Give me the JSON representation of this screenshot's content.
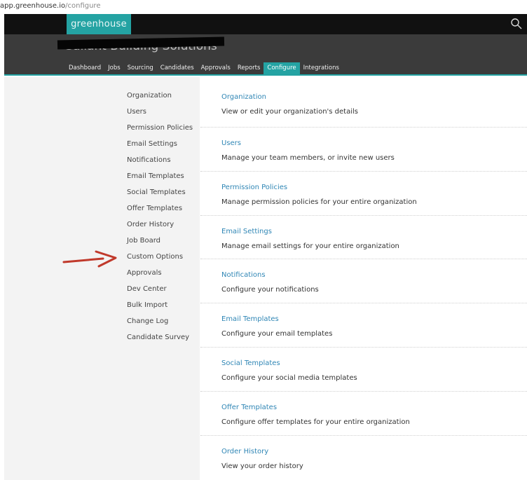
{
  "browser": {
    "url_host": "app.greenhouse.io",
    "url_path": "/configure"
  },
  "header": {
    "logo_text": "greenhouse",
    "org_name": "Gallant Building Solutions",
    "search_icon": "search-icon"
  },
  "nav": {
    "items": [
      {
        "label": "Dashboard"
      },
      {
        "label": "Jobs"
      },
      {
        "label": "Sourcing"
      },
      {
        "label": "Candidates"
      },
      {
        "label": "Approvals"
      },
      {
        "label": "Reports"
      },
      {
        "label": "Configure",
        "active": true
      },
      {
        "label": "Integrations"
      }
    ],
    "active_color": "#24a3a3"
  },
  "sidebar": {
    "items": [
      {
        "label": "Organization"
      },
      {
        "label": "Users"
      },
      {
        "label": "Permission Policies"
      },
      {
        "label": "Email Settings"
      },
      {
        "label": "Notifications"
      },
      {
        "label": "Email Templates"
      },
      {
        "label": "Social Templates"
      },
      {
        "label": "Offer Templates"
      },
      {
        "label": "Order History"
      },
      {
        "label": "Job Board"
      },
      {
        "label": "Custom Options"
      },
      {
        "label": "Approvals"
      },
      {
        "label": "Dev Center"
      },
      {
        "label": "Bulk Import"
      },
      {
        "label": "Change Log"
      },
      {
        "label": "Candidate Survey"
      }
    ]
  },
  "annotation": {
    "arrow_icon": "arrow-right-icon",
    "arrow_color": "#c0392b"
  },
  "main": {
    "sections": [
      {
        "title": "Organization",
        "desc": "View or edit your organization's details"
      },
      {
        "title": "Users",
        "desc": "Manage your team members, or invite new users"
      },
      {
        "title": "Permission Policies",
        "desc": "Manage permission policies for your entire organization"
      },
      {
        "title": "Email Settings",
        "desc": "Manage email settings for your entire organization"
      },
      {
        "title": "Notifications",
        "desc": "Configure your notifications"
      },
      {
        "title": "Email Templates",
        "desc": "Configure your email templates"
      },
      {
        "title": "Social Templates",
        "desc": "Configure your social media templates"
      },
      {
        "title": "Offer Templates",
        "desc": "Configure offer templates for your entire organization"
      },
      {
        "title": "Order History",
        "desc": "View your order history"
      }
    ],
    "link_color": "#2f86b5"
  }
}
